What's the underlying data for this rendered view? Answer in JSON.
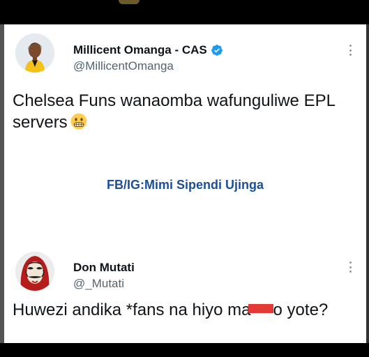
{
  "tweet1": {
    "display_name": "Millicent Omanga - CAS",
    "handle": "@MillicentOmanga",
    "text": "Chelsea Funs wanaomba wafunguliwe EPL servers",
    "emoji": "grimacing-face-emoji",
    "verified": true
  },
  "watermark": "FB/IG:Mimi Sipendi Ujinga",
  "tweet2": {
    "display_name": "Don Mutati",
    "handle": "@_Mutati",
    "text_before": "Huwezi andika *fans na hiyo ma",
    "text_after": "o yote?"
  },
  "colors": {
    "verified_blue": "#1d9bf0",
    "watermark_blue": "#1d4e9b",
    "redaction_red": "#e53935"
  }
}
